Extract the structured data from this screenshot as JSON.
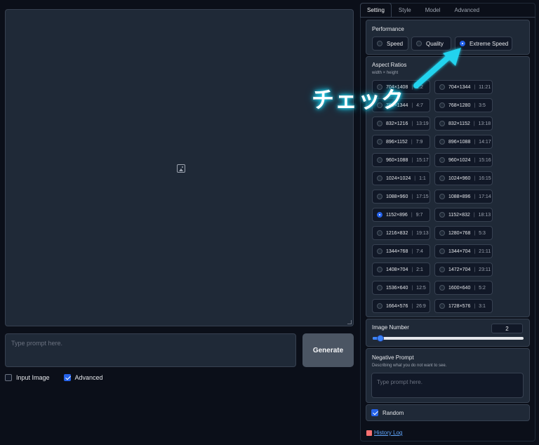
{
  "main": {
    "prompt_placeholder": "Type prompt here.",
    "generate_label": "Generate",
    "input_image_label": "Input Image",
    "input_image_checked": false,
    "advanced_label": "Advanced",
    "advanced_checked": true
  },
  "tabs": [
    {
      "label": "Setting",
      "active": true
    },
    {
      "label": "Style",
      "active": false
    },
    {
      "label": "Model",
      "active": false
    },
    {
      "label": "Advanced",
      "active": false
    }
  ],
  "performance": {
    "title": "Performance",
    "options": [
      {
        "label": "Speed",
        "selected": false
      },
      {
        "label": "Quality",
        "selected": false
      },
      {
        "label": "Extreme Speed",
        "selected": true
      }
    ]
  },
  "aspect_ratios": {
    "title": "Aspect Ratios",
    "subtitle": "width × height",
    "items": [
      {
        "value": "704×1408",
        "ratio": "1:2",
        "selected": false
      },
      {
        "value": "704×1344",
        "ratio": "11:21",
        "selected": false
      },
      {
        "value": "768×1344",
        "ratio": "4:7",
        "selected": false
      },
      {
        "value": "768×1280",
        "ratio": "3:5",
        "selected": false
      },
      {
        "value": "832×1216",
        "ratio": "13:19",
        "selected": false
      },
      {
        "value": "832×1152",
        "ratio": "13:18",
        "selected": false
      },
      {
        "value": "896×1152",
        "ratio": "7:9",
        "selected": false
      },
      {
        "value": "896×1088",
        "ratio": "14:17",
        "selected": false
      },
      {
        "value": "960×1088",
        "ratio": "15:17",
        "selected": false
      },
      {
        "value": "960×1024",
        "ratio": "15:16",
        "selected": false
      },
      {
        "value": "1024×1024",
        "ratio": "1:1",
        "selected": false
      },
      {
        "value": "1024×960",
        "ratio": "16:15",
        "selected": false
      },
      {
        "value": "1088×960",
        "ratio": "17:15",
        "selected": false
      },
      {
        "value": "1088×896",
        "ratio": "17:14",
        "selected": false
      },
      {
        "value": "1152×896",
        "ratio": "9:7",
        "selected": true
      },
      {
        "value": "1152×832",
        "ratio": "18:13",
        "selected": false
      },
      {
        "value": "1216×832",
        "ratio": "19:13",
        "selected": false
      },
      {
        "value": "1280×768",
        "ratio": "5:3",
        "selected": false
      },
      {
        "value": "1344×768",
        "ratio": "7:4",
        "selected": false
      },
      {
        "value": "1344×704",
        "ratio": "21:11",
        "selected": false
      },
      {
        "value": "1408×704",
        "ratio": "2:1",
        "selected": false
      },
      {
        "value": "1472×704",
        "ratio": "23:11",
        "selected": false
      },
      {
        "value": "1536×640",
        "ratio": "12:5",
        "selected": false
      },
      {
        "value": "1600×640",
        "ratio": "5:2",
        "selected": false
      },
      {
        "value": "1664×576",
        "ratio": "26:9",
        "selected": false
      },
      {
        "value": "1728×576",
        "ratio": "3:1",
        "selected": false
      }
    ]
  },
  "image_number": {
    "title": "Image Number",
    "value": "2",
    "level": 0.03
  },
  "negative_prompt": {
    "title": "Negative Prompt",
    "subtitle": "Describing what you do not want to see.",
    "placeholder": "Type prompt here."
  },
  "random": {
    "label": "Random",
    "checked": true
  },
  "history_log": "History Log",
  "annotation": "チェック",
  "colors": {
    "accent": "#2563eb",
    "annotation_glow": "#22d3ee"
  }
}
